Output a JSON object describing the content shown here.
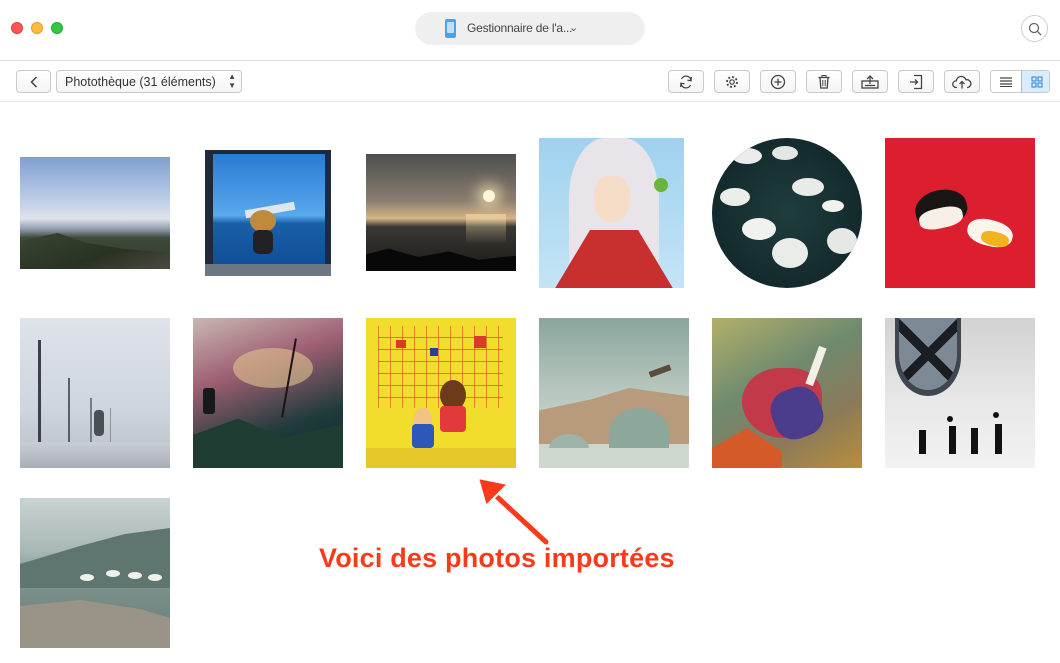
{
  "window": {
    "controls": [
      "close",
      "minimize",
      "maximize"
    ],
    "device_name": "Gestionnaire de l'a...",
    "device_icon": "phone-icon",
    "search_icon": "search-icon"
  },
  "toolbar": {
    "back_icon": "chevron-left-icon",
    "album_label": "Photothèque (31 éléments)",
    "actions": [
      {
        "name": "refresh-button",
        "icon": "refresh-icon"
      },
      {
        "name": "settings-button",
        "icon": "gear-icon"
      },
      {
        "name": "add-button",
        "icon": "plus-circle-icon"
      },
      {
        "name": "delete-button",
        "icon": "trash-icon"
      },
      {
        "name": "export-to-computer-button",
        "icon": "export-icon"
      },
      {
        "name": "send-to-device-button",
        "icon": "send-icon"
      },
      {
        "name": "upload-cloud-button",
        "icon": "cloud-upload-icon"
      }
    ],
    "view_modes": [
      {
        "name": "list-view-button",
        "icon": "list-icon",
        "active": false
      },
      {
        "name": "grid-view-button",
        "icon": "grid-icon",
        "active": true
      }
    ],
    "active_view_color": "#d9ecfb"
  },
  "photos": [
    {
      "name": "photo-coastal-cliff",
      "shape": "rect"
    },
    {
      "name": "photo-window-doll-ocean",
      "shape": "rect"
    },
    {
      "name": "photo-sunset-sea",
      "shape": "rect"
    },
    {
      "name": "photo-anime-character",
      "shape": "rect"
    },
    {
      "name": "photo-swans",
      "shape": "oval"
    },
    {
      "name": "photo-red-illustration",
      "shape": "rect"
    },
    {
      "name": "photo-foggy-poles",
      "shape": "rect"
    },
    {
      "name": "photo-painted-landscape",
      "shape": "rect"
    },
    {
      "name": "photo-museum-figures",
      "shape": "rect"
    },
    {
      "name": "photo-stone-bridge",
      "shape": "rect"
    },
    {
      "name": "photo-bird-painting",
      "shape": "rect"
    },
    {
      "name": "photo-people-balloons",
      "shape": "rect"
    },
    {
      "name": "photo-mountain-geese",
      "shape": "rect"
    }
  ],
  "annotation": {
    "text": "Voici des photos importées",
    "color": "#fb3a1c"
  }
}
